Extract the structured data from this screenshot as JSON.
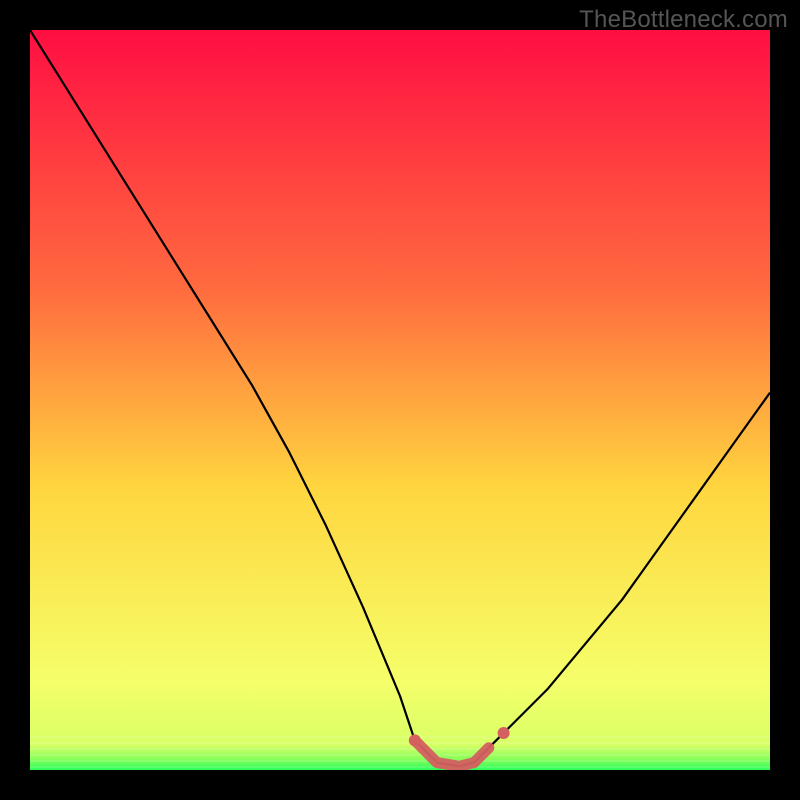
{
  "watermark": "TheBottleneck.com",
  "chart_data": {
    "type": "line",
    "title": "",
    "xlabel": "",
    "ylabel": "",
    "xlim": [
      0,
      100
    ],
    "ylim": [
      0,
      100
    ],
    "x": [
      0,
      5,
      10,
      15,
      20,
      25,
      30,
      35,
      40,
      45,
      50,
      52,
      55,
      58,
      60,
      62,
      65,
      70,
      75,
      80,
      85,
      90,
      95,
      100
    ],
    "bottleneck_values": [
      100,
      92,
      84,
      76,
      68,
      60,
      52,
      43,
      33,
      22,
      10,
      4,
      1,
      0.5,
      1,
      3,
      6,
      11,
      17,
      23,
      30,
      37,
      44,
      51
    ],
    "optimal_region": {
      "x_start": 52,
      "x_end": 64
    },
    "colors": {
      "gradient_top": "#ff0e42",
      "gradient_mid_top": "#ff6b3f",
      "gradient_mid": "#ffd63f",
      "gradient_low": "#f5ff6a",
      "gradient_bottom": "#2aff5a",
      "curve": "#000000",
      "marker": "#d46060"
    }
  }
}
